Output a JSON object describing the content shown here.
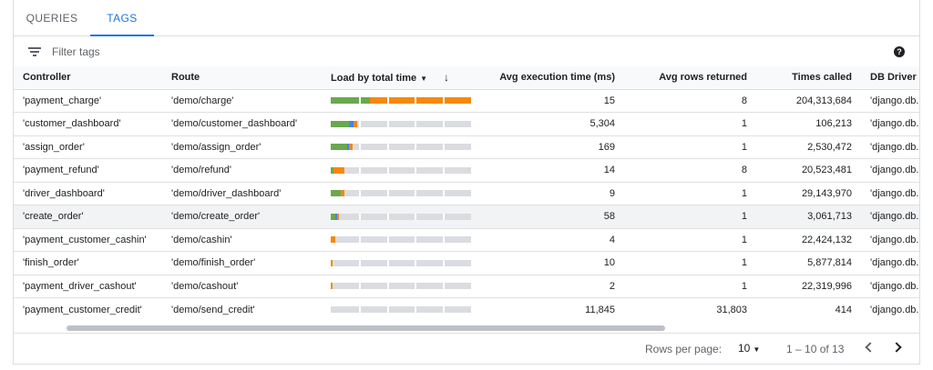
{
  "tabs": [
    {
      "label": "QUERIES",
      "active": false
    },
    {
      "label": "TAGS",
      "active": true
    }
  ],
  "filter": {
    "placeholder": "Filter tags",
    "value": ""
  },
  "table": {
    "columns": {
      "controller": "Controller",
      "route": "Route",
      "load": "Load by total time",
      "avg_exec": "Avg execution time (ms)",
      "avg_rows": "Avg rows returned",
      "times_called": "Times called",
      "db_driver": "DB Driver"
    },
    "rows": [
      {
        "controller": "'payment_charge'",
        "route": "'demo/charge'",
        "avg_exec": "15",
        "avg_rows": "8",
        "times_called": "204,313,684",
        "db_driver": "'django.db.b",
        "load": {
          "green": 0.28,
          "blue": 0.0,
          "orange": 0.72
        }
      },
      {
        "controller": "'customer_dashboard'",
        "route": "'demo/customer_dashboard'",
        "avg_exec": "5,304",
        "avg_rows": "1",
        "times_called": "106,213",
        "db_driver": "'django.db.b",
        "load": {
          "green": 0.13,
          "blue": 0.03,
          "orange": 0.03
        }
      },
      {
        "controller": "'assign_order'",
        "route": "'demo/assign_order'",
        "avg_exec": "169",
        "avg_rows": "1",
        "times_called": "2,530,472",
        "db_driver": "'django.db.b",
        "load": {
          "green": 0.12,
          "blue": 0.01,
          "orange": 0.02
        }
      },
      {
        "controller": "'payment_refund'",
        "route": "'demo/refund'",
        "avg_exec": "14",
        "avg_rows": "8",
        "times_called": "20,523,481",
        "db_driver": "'django.db.b",
        "load": {
          "green": 0.02,
          "blue": 0.0,
          "orange": 0.08
        }
      },
      {
        "controller": "'driver_dashboard'",
        "route": "'demo/driver_dashboard'",
        "avg_exec": "9",
        "avg_rows": "1",
        "times_called": "29,143,970",
        "db_driver": "'django.db.b",
        "load": {
          "green": 0.07,
          "blue": 0.0,
          "orange": 0.03
        }
      },
      {
        "controller": "'create_order'",
        "route": "'demo/create_order'",
        "avg_exec": "58",
        "avg_rows": "1",
        "times_called": "3,061,713",
        "db_driver": "'django.db.b",
        "load": {
          "green": 0.03,
          "blue": 0.01,
          "orange": 0.01
        }
      },
      {
        "controller": "'payment_customer_cashin'",
        "route": "'demo/cashin'",
        "avg_exec": "4",
        "avg_rows": "1",
        "times_called": "22,424,132",
        "db_driver": "'django.db.b",
        "load": {
          "green": 0.0,
          "blue": 0.0,
          "orange": 0.03
        }
      },
      {
        "controller": "'finish_order'",
        "route": "'demo/finish_order'",
        "avg_exec": "10",
        "avg_rows": "1",
        "times_called": "5,877,814",
        "db_driver": "'django.db.b",
        "load": {
          "green": 0.0,
          "blue": 0.0,
          "orange": 0.015
        }
      },
      {
        "controller": "'payment_driver_cashout'",
        "route": "'demo/cashout'",
        "avg_exec": "2",
        "avg_rows": "1",
        "times_called": "22,319,996",
        "db_driver": "'django.db.b",
        "load": {
          "green": 0.0,
          "blue": 0.0,
          "orange": 0.015
        }
      },
      {
        "controller": "'payment_customer_credit'",
        "route": "'demo/send_credit'",
        "avg_exec": "11,845",
        "avg_rows": "31,803",
        "times_called": "414",
        "db_driver": "'django.db.b",
        "load": {
          "green": 0.0,
          "blue": 0.0,
          "orange": 0.0
        }
      }
    ]
  },
  "pagination": {
    "rows_per_page_label": "Rows per page:",
    "rows_per_page": "10",
    "range": "1 – 10 of 13"
  },
  "icons": {
    "filter": "filter-icon",
    "help": "help-icon",
    "sort": "arrow-down-icon",
    "prev": "chevron-left-icon",
    "next": "chevron-right-icon"
  },
  "colors": {
    "accent": "#1a73e8",
    "green": "#6aa84f",
    "blue": "#4285f4",
    "orange": "#f5890a",
    "track": "#dadce0"
  }
}
